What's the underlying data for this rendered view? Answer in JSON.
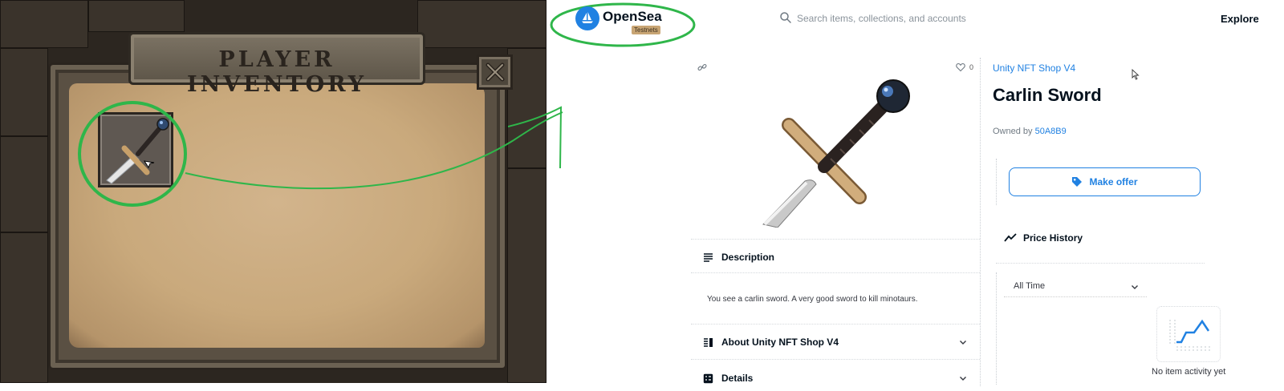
{
  "game": {
    "title": "PLAYER INVENTORY",
    "close_label": "X"
  },
  "opensea": {
    "brand": "OpenSea",
    "badge": "Testnets",
    "search_placeholder": "Search items, collections, and accounts",
    "nav_explore": "Explore",
    "favorites_count": "0",
    "collection": "Unity NFT Shop V4",
    "item_name": "Carlin Sword",
    "owned_by_label": "Owned by",
    "owner": "50A8B9",
    "make_offer": "Make offer",
    "sections": {
      "description": "Description",
      "description_text": "You see a carlin sword. A very good sword to kill minotaurs.",
      "about": "About Unity NFT Shop V4",
      "details": "Details"
    },
    "price_history": "Price History",
    "time_range": "All Time",
    "no_activity": "No item activity yet"
  },
  "colors": {
    "accent": "#2081e2",
    "annotation_green": "#2fb64a",
    "parchment": "#c9a97c"
  }
}
